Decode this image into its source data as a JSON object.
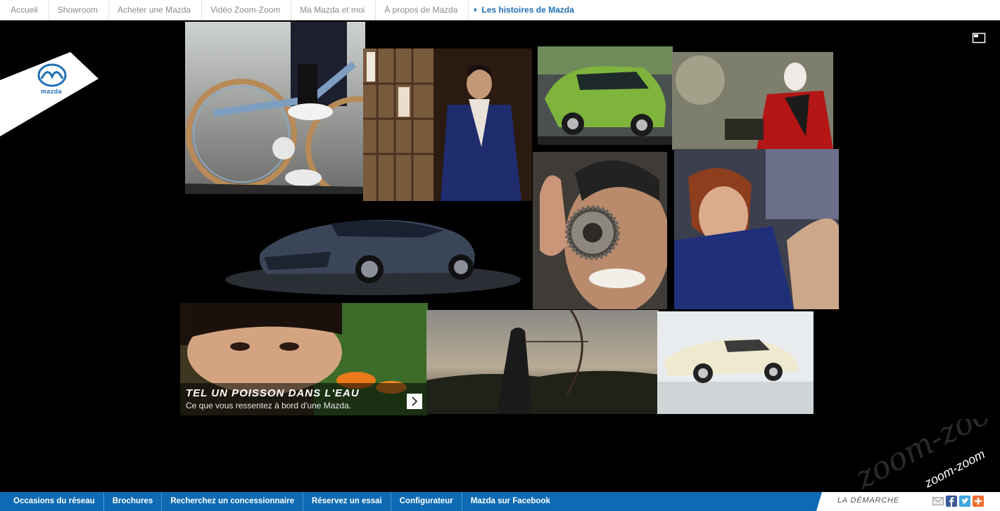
{
  "top_nav": {
    "items": [
      {
        "label": "Accueil"
      },
      {
        "label": "Showroom"
      },
      {
        "label": "Acheter une Mazda"
      },
      {
        "label": "Vidéo Zoom-Zoom"
      },
      {
        "label": "Ma Mazda et moi"
      },
      {
        "label": "À propos de Mazda"
      },
      {
        "label": "Les histoires de Mazda"
      }
    ],
    "active_index": 6
  },
  "brand": {
    "logo_text": "mazda"
  },
  "icons": {
    "fullscreen": "fullscreen-icon",
    "caption_arrow": "chevron-right-icon",
    "email": "email-icon",
    "facebook": "facebook-icon",
    "twitter": "twitter-icon",
    "more": "plus-icon"
  },
  "feature": {
    "title": "TEL UN POISSON DANS L'EAU",
    "subtitle": "Ce que vous ressentez à bord d'une Mazda."
  },
  "bottom_nav": {
    "items": [
      {
        "label": "Occasions du réseau"
      },
      {
        "label": "Brochures"
      },
      {
        "label": "Recherchez un concessionnaire"
      },
      {
        "label": "Réservez un essai"
      },
      {
        "label": "Configurateur"
      },
      {
        "label": "Mazda sur Facebook"
      }
    ],
    "demarche": "LA DÉMARCHE"
  },
  "watermark": {
    "text": "zoom-zoom"
  },
  "colors": {
    "brand_blue": "#0d6ab3",
    "nav_active": "#1f6fb5",
    "background": "#000000"
  }
}
